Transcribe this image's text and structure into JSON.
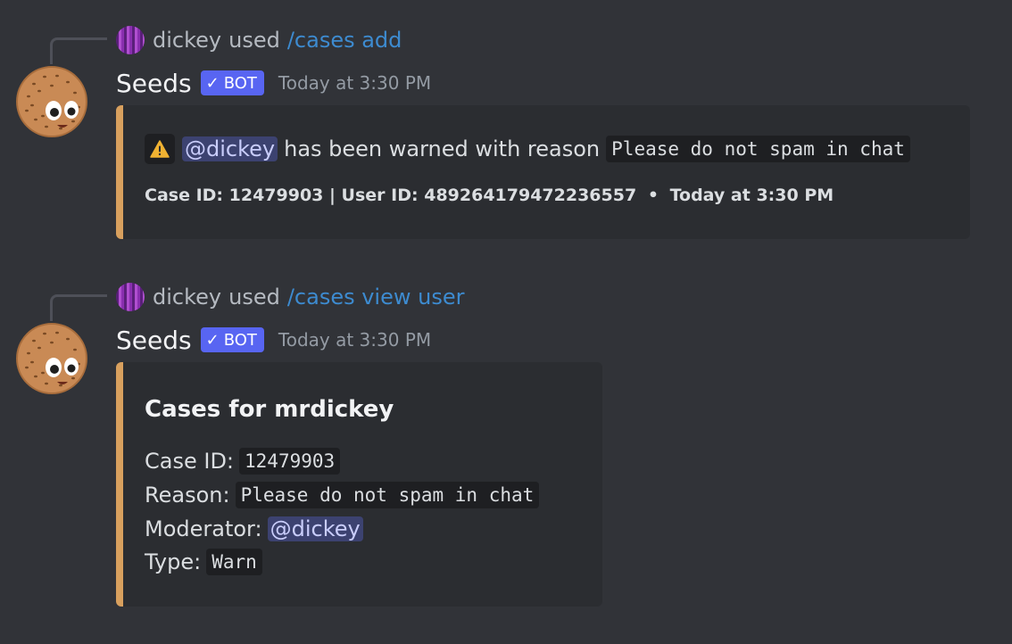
{
  "messages": [
    {
      "reply": {
        "user": "dickey",
        "used": "used",
        "command": "/cases add"
      },
      "author": "Seeds",
      "bot_tag": "BOT",
      "bot_check": "✓",
      "timestamp": "Today at 3:30 PM",
      "embed": {
        "icon": "warning-icon",
        "mention": "@dickey",
        "text": "has been warned with reason",
        "reason": "Please do not spam in chat",
        "footer": "Case ID: 12479903 | User ID: 489264179472236557",
        "footer_sep": "•",
        "footer_time": "Today at 3:30 PM"
      }
    },
    {
      "reply": {
        "user": "dickey",
        "used": "used",
        "command": "/cases view user"
      },
      "author": "Seeds",
      "bot_tag": "BOT",
      "bot_check": "✓",
      "timestamp": "Today at 3:30 PM",
      "embed": {
        "title": "Cases for mrdickey",
        "fields": [
          {
            "label": "Case ID:",
            "value": "12479903"
          },
          {
            "label": "Reason:",
            "value": "Please do not spam in chat"
          },
          {
            "label": "Moderator:",
            "value": "@dickey"
          },
          {
            "label": "Type:",
            "value": "Warn"
          }
        ]
      }
    }
  ],
  "colors": {
    "background": "#313338",
    "embed_bg": "#2b2d31",
    "embed_accent": "#d8a05e",
    "command_link": "#3d8bd0",
    "bot_tag": "#5865f2",
    "mention_bg": "#3c4270"
  }
}
